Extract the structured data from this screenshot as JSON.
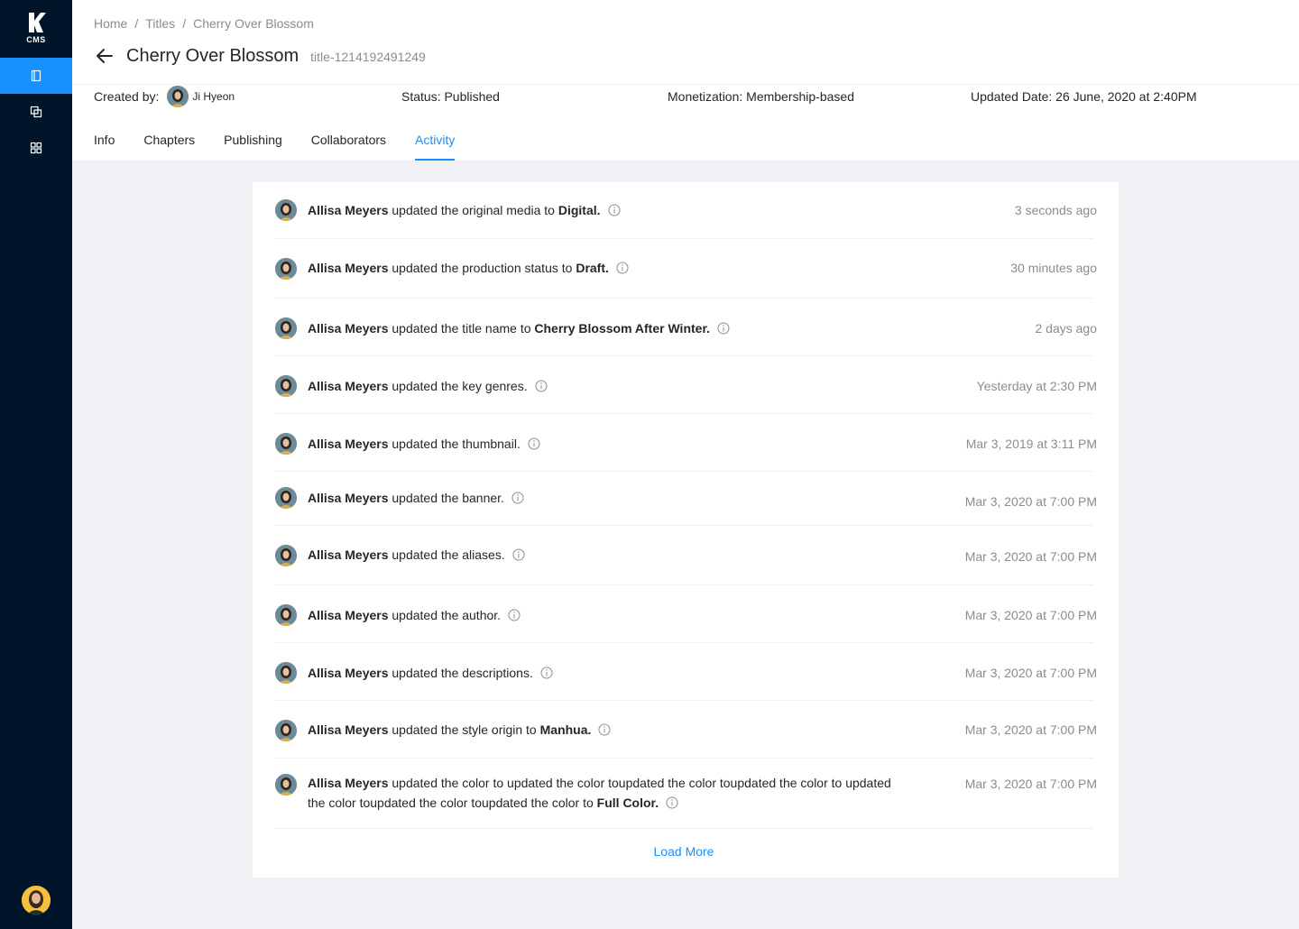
{
  "app": {
    "logo_text": "CMS"
  },
  "breadcrumb": [
    "Home",
    "Titles",
    "Cherry Over Blossom"
  ],
  "breadcrumb_sep": "/",
  "title": {
    "name": "Cherry Over Blossom",
    "id": "title-1214192491249"
  },
  "meta": {
    "created_label": "Created by:",
    "creator": "Ji Hyeon",
    "status": "Status: Published",
    "monetization": "Monetization: Membership-based",
    "updated": "Updated Date: 26 June, 2020 at 2:40PM"
  },
  "tabs": [
    {
      "label": "Info",
      "active": false
    },
    {
      "label": "Chapters",
      "active": false
    },
    {
      "label": "Publishing",
      "active": false
    },
    {
      "label": "Collaborators",
      "active": false
    },
    {
      "label": "Activity",
      "active": true
    }
  ],
  "activity": [
    {
      "user": "Allisa Meyers",
      "action": "updated the original media to",
      "value": "Digital.",
      "time": "3 seconds ago"
    },
    {
      "user": "Allisa Meyers",
      "action": "updated the production status to",
      "value": "Draft.",
      "time": "30 minutes ago"
    },
    {
      "user": "Allisa Meyers",
      "action": "updated the title name to",
      "value": "Cherry Blossom After Winter.",
      "time": "2 days ago"
    },
    {
      "user": "Allisa Meyers",
      "action": "updated the key genres.",
      "value": "",
      "time": "Yesterday at 2:30 PM"
    },
    {
      "user": "Allisa Meyers",
      "action": "updated the thumbnail.",
      "value": "",
      "time": "Mar 3, 2019 at 3:11 PM"
    },
    {
      "user": "Allisa Meyers",
      "action": "updated the banner.",
      "value": "",
      "time": "Mar 3, 2020 at 7:00 PM"
    },
    {
      "user": "Allisa Meyers",
      "action": "updated the aliases.",
      "value": "",
      "time": "Mar 3, 2020 at 7:00 PM"
    },
    {
      "user": "Allisa Meyers",
      "action": "updated the author.",
      "value": "",
      "time": "Mar 3, 2020 at 7:00 PM"
    },
    {
      "user": "Allisa Meyers",
      "action": "updated the descriptions.",
      "value": "",
      "time": "Mar 3, 2020 at 7:00 PM"
    },
    {
      "user": "Allisa Meyers",
      "action": "updated the style origin to",
      "value": "Manhua.",
      "time": "Mar 3, 2020 at 7:00 PM"
    },
    {
      "user": "Allisa Meyers",
      "action": "updated the color to updated the color toupdated the color toupdated the color to updated the color toupdated the color toupdated the color to",
      "value": "Full Color.",
      "time": "Mar 3, 2020 at 7:00 PM"
    }
  ],
  "load_more": "Load More",
  "colors": {
    "sidebar": "#001529",
    "accent": "#1890ff",
    "muted": "#8c8c8c"
  },
  "icons": {
    "back": "arrow-left-icon",
    "info": "info-circle-icon",
    "nav": [
      "book-icon",
      "copy-icon",
      "grid-icon"
    ]
  }
}
